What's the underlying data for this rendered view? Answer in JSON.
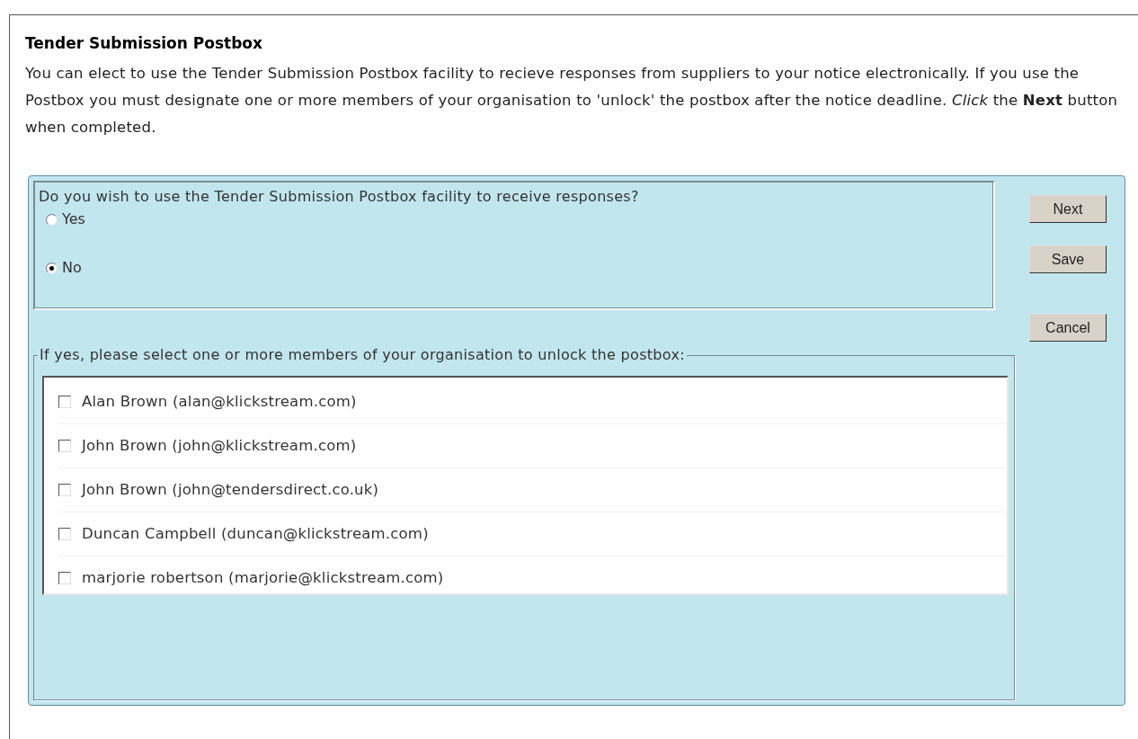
{
  "heading": "Tender Submission Postbox",
  "intro": "You can elect to use the Tender Submission Postbox facility to recieve responses from suppliers to your notice electronically. If you use the Postbox you must designate one or more members of your organisation to 'unlock' the postbox after the notice deadline. *Click* the **Next** button when completed.",
  "question": {
    "label": "Do you wish to use the Tender Submission Postbox facility to receive responses?",
    "options": [
      {
        "label": "Yes",
        "selected": false
      },
      {
        "label": "No",
        "selected": true
      }
    ]
  },
  "buttons": [
    "Next",
    "Save",
    "Cancel"
  ],
  "members": {
    "legend": "If yes, please select one or more members of your organisation to unlock the postbox:",
    "items": [
      {
        "label": "Alan Brown (alan@klickstream.com)",
        "checked": false
      },
      {
        "label": "John Brown (john@klickstream.com)",
        "checked": false
      },
      {
        "label": "John Brown (john@tendersdirect.co.uk)",
        "checked": false
      },
      {
        "label": "Duncan Campbell (duncan@klickstream.com)",
        "checked": false
      },
      {
        "label": "marjorie robertson (marjorie@klickstream.com)",
        "checked": false
      }
    ]
  }
}
